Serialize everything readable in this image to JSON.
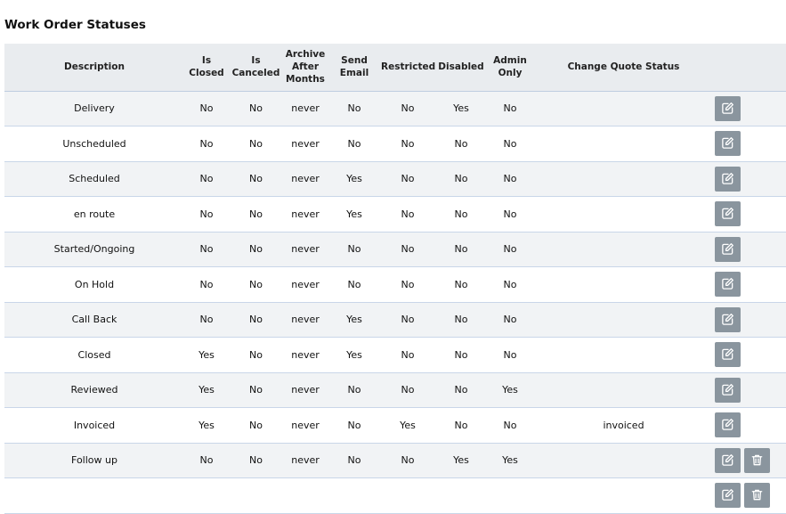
{
  "page_title": "Work Order Statuses",
  "columns": [
    "Description",
    "Is Closed",
    "Is Canceled",
    "Archive After Months",
    "Send Email",
    "Restricted",
    "Disabled",
    "Admin Only",
    "Change Quote Status",
    ""
  ],
  "rows": [
    {
      "description": "Delivery",
      "is_closed": "No",
      "is_canceled": "No",
      "archive_after": "never",
      "send_email": "No",
      "restricted": "No",
      "disabled": "Yes",
      "admin_only": "No",
      "change_quote_status": "",
      "can_delete": false
    },
    {
      "description": "Unscheduled",
      "is_closed": "No",
      "is_canceled": "No",
      "archive_after": "never",
      "send_email": "No",
      "restricted": "No",
      "disabled": "No",
      "admin_only": "No",
      "change_quote_status": "",
      "can_delete": false
    },
    {
      "description": "Scheduled",
      "is_closed": "No",
      "is_canceled": "No",
      "archive_after": "never",
      "send_email": "Yes",
      "restricted": "No",
      "disabled": "No",
      "admin_only": "No",
      "change_quote_status": "",
      "can_delete": false
    },
    {
      "description": "en route",
      "is_closed": "No",
      "is_canceled": "No",
      "archive_after": "never",
      "send_email": "Yes",
      "restricted": "No",
      "disabled": "No",
      "admin_only": "No",
      "change_quote_status": "",
      "can_delete": false
    },
    {
      "description": "Started/Ongoing",
      "is_closed": "No",
      "is_canceled": "No",
      "archive_after": "never",
      "send_email": "No",
      "restricted": "No",
      "disabled": "No",
      "admin_only": "No",
      "change_quote_status": "",
      "can_delete": false
    },
    {
      "description": "On Hold",
      "is_closed": "No",
      "is_canceled": "No",
      "archive_after": "never",
      "send_email": "No",
      "restricted": "No",
      "disabled": "No",
      "admin_only": "No",
      "change_quote_status": "",
      "can_delete": false
    },
    {
      "description": "Call Back",
      "is_closed": "No",
      "is_canceled": "No",
      "archive_after": "never",
      "send_email": "Yes",
      "restricted": "No",
      "disabled": "No",
      "admin_only": "No",
      "change_quote_status": "",
      "can_delete": false
    },
    {
      "description": "Closed",
      "is_closed": "Yes",
      "is_canceled": "No",
      "archive_after": "never",
      "send_email": "Yes",
      "restricted": "No",
      "disabled": "No",
      "admin_only": "No",
      "change_quote_status": "",
      "can_delete": false
    },
    {
      "description": "Reviewed",
      "is_closed": "Yes",
      "is_canceled": "No",
      "archive_after": "never",
      "send_email": "No",
      "restricted": "No",
      "disabled": "No",
      "admin_only": "Yes",
      "change_quote_status": "",
      "can_delete": false
    },
    {
      "description": "Invoiced",
      "is_closed": "Yes",
      "is_canceled": "No",
      "archive_after": "never",
      "send_email": "No",
      "restricted": "Yes",
      "disabled": "No",
      "admin_only": "No",
      "change_quote_status": "invoiced",
      "can_delete": false
    },
    {
      "description": "Follow up",
      "is_closed": "No",
      "is_canceled": "No",
      "archive_after": "never",
      "send_email": "No",
      "restricted": "No",
      "disabled": "Yes",
      "admin_only": "Yes",
      "change_quote_status": "",
      "can_delete": true
    },
    {
      "description": "",
      "is_closed": "",
      "is_canceled": "",
      "archive_after": "",
      "send_email": "",
      "restricted": "",
      "disabled": "",
      "admin_only": "",
      "change_quote_status": "",
      "can_delete": true
    }
  ],
  "icons": {
    "edit": "edit-icon",
    "delete": "trash-icon"
  },
  "colors": {
    "button_bg": "#8a959e",
    "header_bg": "#e9ecef",
    "row_alt_bg": "#f1f3f5",
    "row_border": "#c9d6e8",
    "link": "#2a62c9"
  }
}
